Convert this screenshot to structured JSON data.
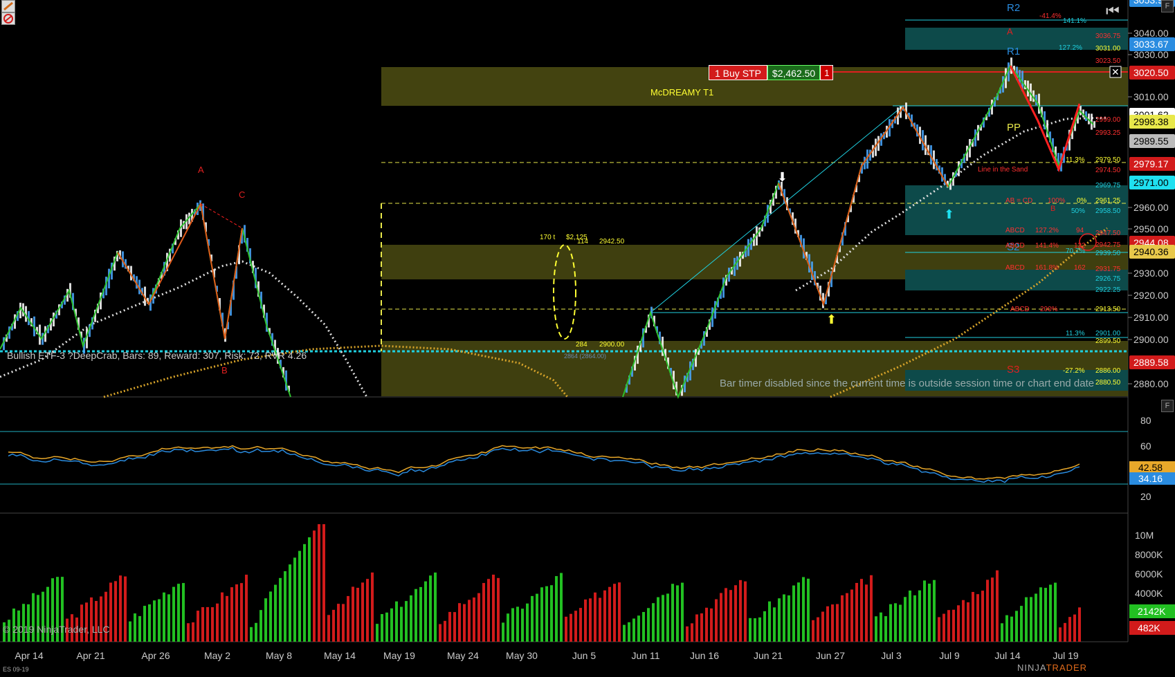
{
  "toolbar": {
    "buy_order_label": "1 Buy STP",
    "order_pnl": "$2,462.50",
    "order_qty": "1"
  },
  "overlay_text": {
    "zone_label": "McDREAMY T1",
    "pattern_label": "Bullish ETF-3 ?DeepCrab, Bars: 89, Reward: 307, Risk: 72, RVR 4.26",
    "timer_message": "Bar timer disabled since the current time is outside session time or chart end date",
    "copyright": "© 2019 NinjaTrader, LLC",
    "symbol": "ES 09-19",
    "brand_a": "NINJA",
    "brand_b": "TRADER",
    "pivot_labels": [
      "R2",
      "R1",
      "PP",
      "S2",
      "S3"
    ],
    "swing_labels": [
      "A",
      "C",
      "B",
      "A",
      "B"
    ],
    "annotations": {
      "t1": "170 t",
      "t1b": "$2,125",
      "t1c": "114",
      "t1d": "2942.50",
      "t2": "284",
      "t2b": "2900.00",
      "t2c": "2864 (2864.00)",
      "line_in_sand": "Line in the Sand",
      "abcd1": "ABCD",
      "abcd1_pct": "127.2%",
      "abcd1_val": "94",
      "abcd2": "ABCD",
      "abcd2_pct": "141.4%",
      "abcd2_val": "122",
      "abcd3": "ABCD",
      "abcd3_pct": "161.8%",
      "abcd3_val": "162",
      "abcd4": "ABCD",
      "abcd4_pct": "200%",
      "ab_cd": "AB = CD",
      "ab_cd_pct": "100%",
      "ab_cd_zero": "0%",
      "fib_113": "11.3%",
      "fib_50": "50%",
      "fib_707": "70.7%",
      "fib_neg272": "-27.2%",
      "fib_neg414": "-41.4%",
      "fib_1272": "127.2%",
      "fib_1414": "141.1%",
      "lvl_2979": "2979.50",
      "lvl_2974": "2974.50",
      "lvl_2969": "2969.75",
      "lvl_2961": "2961.25",
      "lvl_2958": "2958.50",
      "lvl_2947": "2947.50",
      "lvl_2942": "2942.75",
      "lvl_2939": "2939.50",
      "lvl_2931": "2931.75",
      "lvl_2926": "2926.75",
      "lvl_2922": "2922.25",
      "lvl_2913": "2913.50",
      "lvl_2901": "2901.00",
      "lvl_2899": "2899.50",
      "lvl_2886": "2886.00",
      "lvl_2880": "2880.50",
      "lvl_2999": "2999.00",
      "lvl_2993": "2993.25",
      "lvl_3023": "3023.50",
      "lvl_3036": "3036.75",
      "lvl_3031": "3031.00"
    }
  },
  "price_axis": {
    "ticks": [
      "3040.00",
      "3030.00",
      "3010.00",
      "2960.00",
      "2950.00",
      "2930.00",
      "2920.00",
      "2910.00",
      "2900.00",
      "2880.00"
    ],
    "markers": [
      {
        "label": "3053.92",
        "color": "#2a8ce0",
        "text_color": "#fff"
      },
      {
        "label": "3033.67",
        "color": "#2a8ce0",
        "text_color": "#fff"
      },
      {
        "label": "3020.50",
        "color": "#d21b1b",
        "text_color": "#fff"
      },
      {
        "label": "3001.62",
        "color": "#ffffff",
        "text_color": "#000"
      },
      {
        "label": "2998.38",
        "color": "#e8e84a",
        "text_color": "#000"
      },
      {
        "label": "2989.55",
        "color": "#bbbbbb",
        "text_color": "#000"
      },
      {
        "label": "2979.17",
        "color": "#d21b1b",
        "text_color": "#fff"
      },
      {
        "label": "2971.00",
        "color": "#1fe0f0",
        "text_color": "#000"
      },
      {
        "label": "2944.08",
        "color": "#d21b1b",
        "text_color": "#fff"
      },
      {
        "label": "2940.36",
        "color": "#e8c84a",
        "text_color": "#000"
      },
      {
        "label": "2889.58",
        "color": "#d21b1b",
        "text_color": "#fff"
      }
    ]
  },
  "osc_axis": {
    "ticks": [
      "80",
      "60",
      "20"
    ],
    "markers": [
      {
        "label": "42.58",
        "color": "#e8a82a",
        "text_color": "#000"
      },
      {
        "label": "34.16",
        "color": "#2a8ce0",
        "text_color": "#fff"
      }
    ]
  },
  "volume_axis": {
    "ticks": [
      "10M",
      "8000K",
      "6000K",
      "4000K"
    ],
    "markers": [
      {
        "label": "2142K",
        "color": "#22c022",
        "text_color": "#fff"
      },
      {
        "label": "482K",
        "color": "#d21b1b",
        "text_color": "#fff"
      }
    ]
  },
  "date_axis": {
    "labels": [
      "Apr 14",
      "Apr 21",
      "Apr 26",
      "May 2",
      "May 8",
      "May 14",
      "May 19",
      "May 24",
      "May 30",
      "Jun 5",
      "Jun 11",
      "Jun 16",
      "Jun 21",
      "Jun 27",
      "Jul 3",
      "Jul 9",
      "Jul 14",
      "Jul 19"
    ]
  },
  "colors": {
    "background": "#000000",
    "up_bar": "#22c022",
    "down_bar": "#d21b1b",
    "zone_fill": "#4a4a12",
    "teal_zone": "#0d4a4a",
    "cyan_line": "#1fd0e0",
    "yellow": "#ffff33"
  }
}
